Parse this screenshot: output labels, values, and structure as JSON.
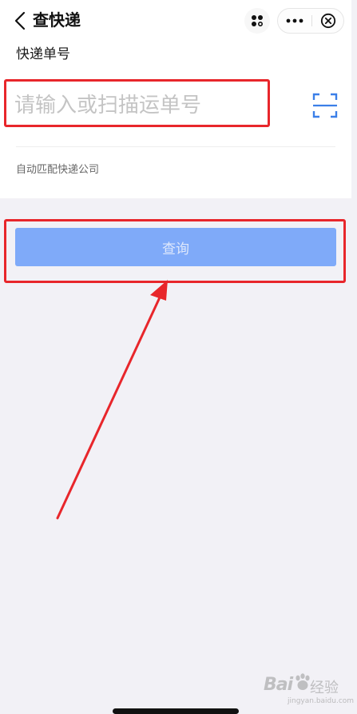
{
  "nav": {
    "title": "查快递",
    "back_icon": "chevron-left-icon",
    "share_icon": "share-icon",
    "more_icon": "more-dots-icon",
    "close_icon": "close-circle-icon"
  },
  "form": {
    "label": "快递单号",
    "input_value": "",
    "input_placeholder": "请输入或扫描运单号",
    "scan_icon": "scan-icon",
    "hint": "自动匹配快递公司"
  },
  "actions": {
    "query_label": "查询"
  },
  "annotation": {
    "highlight_color": "#e8262b",
    "arrow_color": "#e8262b"
  },
  "watermark": {
    "brand": "Bai",
    "brand_suffix": "经验",
    "url": "jingyan.baidu.com"
  },
  "colors": {
    "primary_button": "#7faaf9",
    "scan_icon": "#3b7fe8",
    "page_background": "#f2f1f6"
  }
}
